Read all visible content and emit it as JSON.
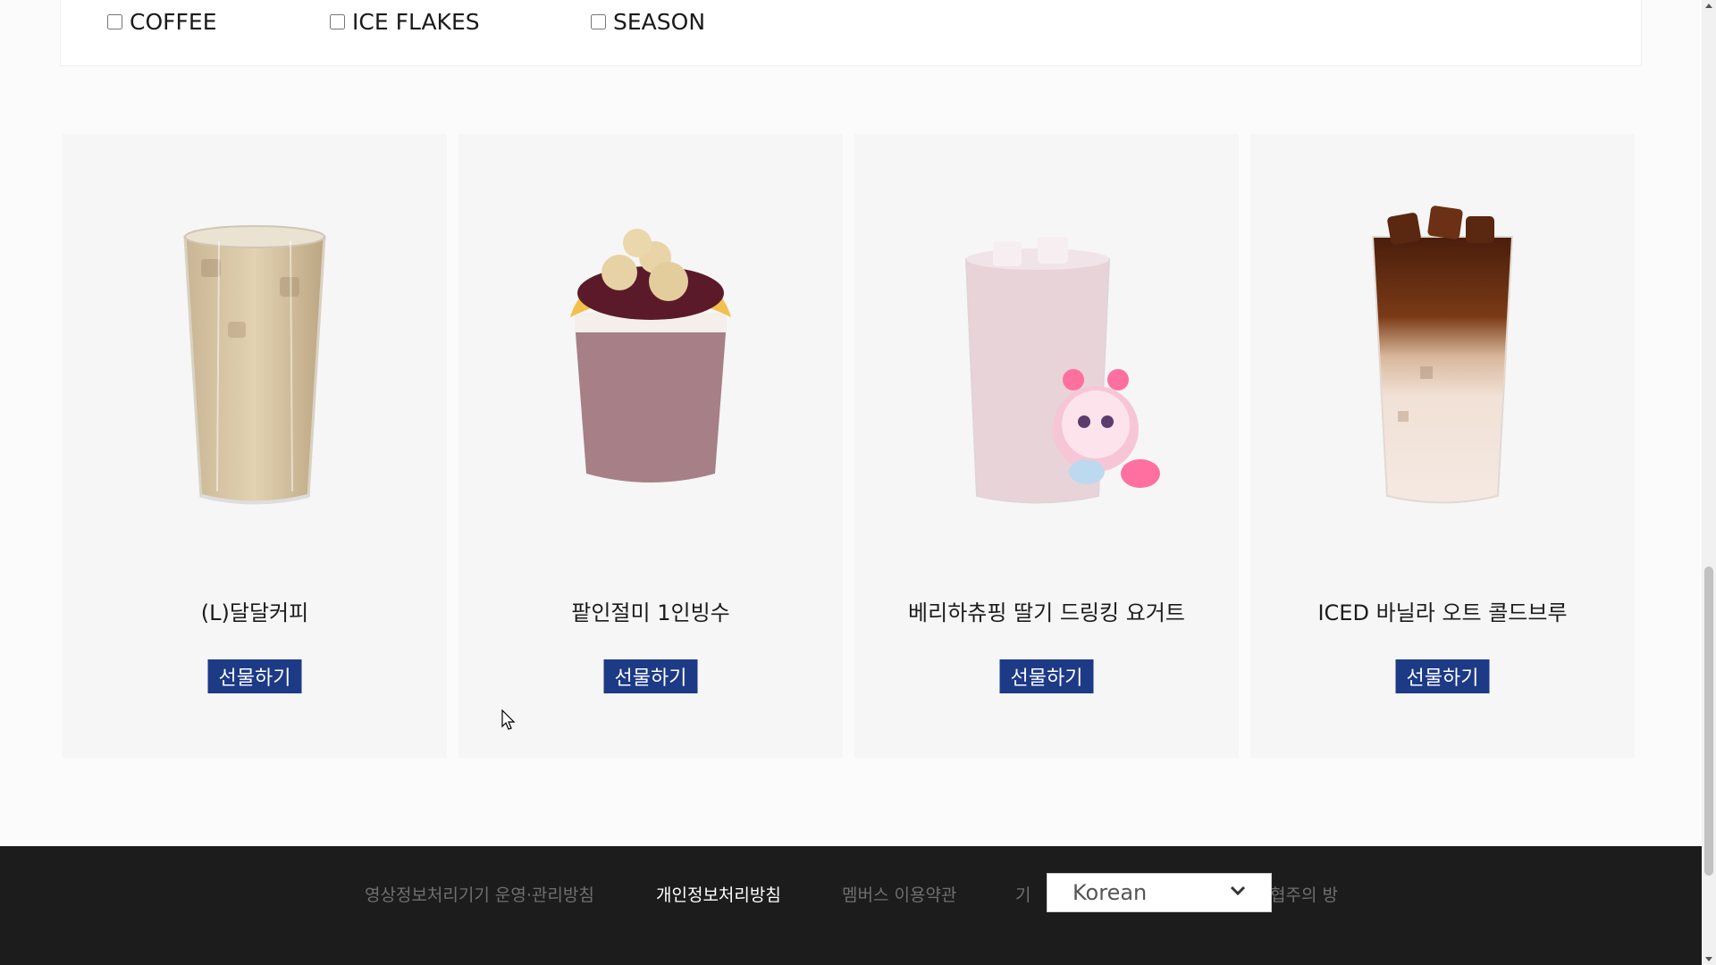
{
  "filters": [
    {
      "label": "COFFEE",
      "checked": false
    },
    {
      "label": "ICE FLAKES",
      "checked": false
    },
    {
      "label": "SEASON",
      "checked": false
    }
  ],
  "products": [
    {
      "name": "(L)달달커피",
      "button": "선물하기",
      "image": "iced-milk-coffee-illustration"
    },
    {
      "name": "팥인절미 1인빙수",
      "button": "선물하기",
      "image": "red-bean-bingsu-illustration"
    },
    {
      "name": "베리하츄핑 딸기 드링킹 요거트",
      "button": "선물하기",
      "image": "strawberry-yogurt-drink-illustration"
    },
    {
      "name": "ICED 바닐라 오트 콜드브루",
      "button": "선물하기",
      "image": "iced-vanilla-oat-cold-brew-illustration"
    }
  ],
  "footer": {
    "links": [
      {
        "label": "영상정보처리기기 운영·관리방침",
        "active": false
      },
      {
        "label": "개인정보처리방침",
        "active": true
      },
      {
        "label": "멤버스 이용약관",
        "active": false
      },
      {
        "label": "기",
        "active": false
      },
      {
        "label": "협주의 방",
        "active": false
      }
    ],
    "language": "Korean"
  },
  "colors": {
    "button_bg": "#1d3a87",
    "footer_bg": "#1c1c1c",
    "card_bg": "#f6f6f6"
  }
}
